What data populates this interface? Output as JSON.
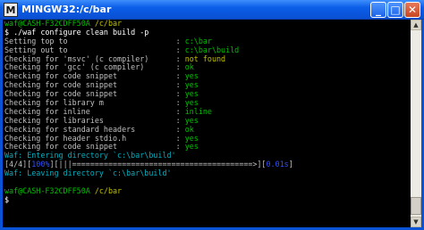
{
  "window": {
    "title": "MINGW32:/c/bar",
    "app_icon_glyph": "M",
    "controls": {
      "minimize": "_",
      "maximize": "□",
      "close": "✕"
    }
  },
  "terminal": {
    "lines": [
      [
        {
          "t": "waf@CASH-F32CDFF50A ",
          "c": "gn"
        },
        {
          "t": "/c/bar",
          "c": "yl"
        }
      ],
      [
        {
          "t": "$ ./waf configure clean build -p",
          "c": "wh"
        }
      ],
      [
        {
          "t": "Setting top to                        : ",
          "c": "gy"
        },
        {
          "t": "c:\\bar",
          "c": "gn"
        }
      ],
      [
        {
          "t": "Setting out to                        : ",
          "c": "gy"
        },
        {
          "t": "c:\\bar\\build",
          "c": "gn"
        }
      ],
      [
        {
          "t": "Checking for 'msvc' (c compiler)      : ",
          "c": "gy"
        },
        {
          "t": "not found",
          "c": "yl"
        }
      ],
      [
        {
          "t": "Checking for 'gcc' (c compiler)       : ",
          "c": "gy"
        },
        {
          "t": "ok",
          "c": "gn"
        }
      ],
      [
        {
          "t": "Checking for code snippet             : ",
          "c": "gy"
        },
        {
          "t": "yes",
          "c": "gn"
        }
      ],
      [
        {
          "t": "Checking for code snippet             : ",
          "c": "gy"
        },
        {
          "t": "yes",
          "c": "gn"
        }
      ],
      [
        {
          "t": "Checking for code snippet             : ",
          "c": "gy"
        },
        {
          "t": "yes",
          "c": "gn"
        }
      ],
      [
        {
          "t": "Checking for library m                : ",
          "c": "gy"
        },
        {
          "t": "yes",
          "c": "gn"
        }
      ],
      [
        {
          "t": "Checking for inline                   : ",
          "c": "gy"
        },
        {
          "t": "inline",
          "c": "gn"
        }
      ],
      [
        {
          "t": "Checking for libraries                : ",
          "c": "gy"
        },
        {
          "t": "yes",
          "c": "gn"
        }
      ],
      [
        {
          "t": "Checking for standard headers         : ",
          "c": "gy"
        },
        {
          "t": "ok",
          "c": "gn"
        }
      ],
      [
        {
          "t": "Checking for header stdio.h           : ",
          "c": "gy"
        },
        {
          "t": "yes",
          "c": "gn"
        }
      ],
      [
        {
          "t": "Checking for code snippet             : ",
          "c": "gy"
        },
        {
          "t": "yes",
          "c": "gn"
        }
      ],
      [
        {
          "t": "Waf: Entering directory `c:\\bar\\build'",
          "c": "cy"
        }
      ],
      [
        {
          "t": "[4/4][",
          "c": "gy"
        },
        {
          "t": "100%",
          "c": "bl"
        },
        {
          "t": "][|||========================================>][",
          "c": "gy"
        },
        {
          "t": "0.01s",
          "c": "bl"
        },
        {
          "t": "]",
          "c": "gy"
        }
      ],
      [
        {
          "t": "Waf: Leaving directory `c:\\bar\\build'",
          "c": "cy"
        }
      ],
      [
        {
          "t": "",
          "c": "gy"
        }
      ],
      [
        {
          "t": "waf@CASH-F32CDFF50A ",
          "c": "gn"
        },
        {
          "t": "/c/bar",
          "c": "yl"
        }
      ],
      [
        {
          "t": "$ ",
          "c": "wh"
        }
      ]
    ]
  }
}
